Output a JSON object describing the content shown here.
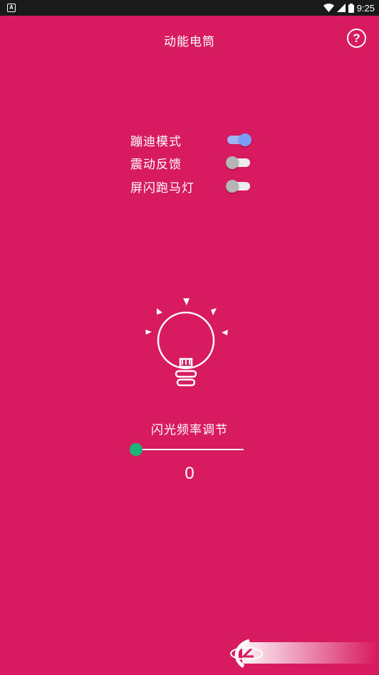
{
  "status_bar": {
    "notification_icon": "a-icon",
    "notification_glyph": "A",
    "time": "9:25",
    "wifi_icon": "wifi-icon",
    "signal_icon": "signal-icon",
    "battery_icon": "battery-icon"
  },
  "header": {
    "title": "动能电筒",
    "help_glyph": "?"
  },
  "settings": [
    {
      "label": "蹦迪模式",
      "enabled": true
    },
    {
      "label": "震动反馈",
      "enabled": false
    },
    {
      "label": "屏闪跑马灯",
      "enabled": false
    }
  ],
  "frequency": {
    "label": "闪光频率调节",
    "value": "0",
    "slider_fraction": 0
  },
  "colors": {
    "background": "#d81b60",
    "switch_on": "#7b9cf7",
    "slider_thumb": "#1ab37a"
  }
}
